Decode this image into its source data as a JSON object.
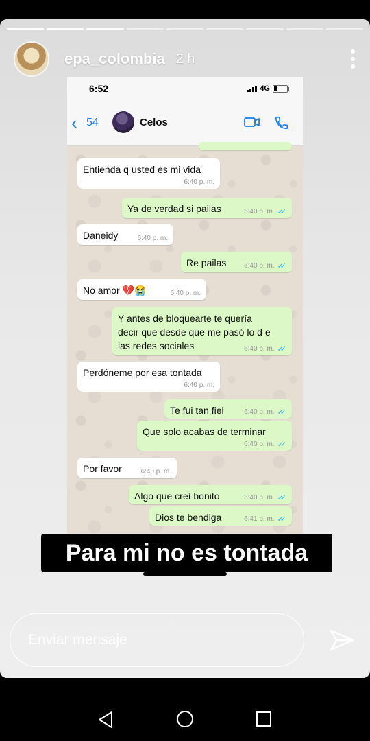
{
  "story": {
    "username": "epa_colombia",
    "time_ago": "2 h",
    "progress_segments": 9,
    "progress_done": 3,
    "caption": "Para mi no es tontada",
    "reply_placeholder": "Enviar mensaje"
  },
  "phone": {
    "status_time": "6:52",
    "network": "4G",
    "back_count": "54",
    "contact_name": "Celos"
  },
  "messages": [
    {
      "dir": "in",
      "text": "Entienda q usted es mi vida",
      "time": "6:40 p. m."
    },
    {
      "dir": "out",
      "text": "Ya de verdad si pailas",
      "time": "6:40 p. m."
    },
    {
      "dir": "in",
      "text": "Daneidy",
      "time": "6:40 p. m."
    },
    {
      "dir": "out",
      "text": "Re pailas",
      "time": "6:40 p. m."
    },
    {
      "dir": "in",
      "text": "No amor 💔😭",
      "time": "6:40 p. m."
    },
    {
      "dir": "out",
      "lines": [
        "Y antes de bloquearte te quería",
        "decir que desde que me pasó lo d e",
        "las redes sociales"
      ],
      "time": "6:40 p. m."
    },
    {
      "dir": "in",
      "text": "Perdóneme por esa tontada",
      "time": "6:40 p. m."
    },
    {
      "dir": "out",
      "text": "Te fui tan fiel",
      "time": "6:40 p. m."
    },
    {
      "dir": "out",
      "text": "Que solo acabas de terminar",
      "time": "6:40 p. m."
    },
    {
      "dir": "in",
      "text": "Por favor",
      "time": "6:40 p. m."
    },
    {
      "dir": "out",
      "text": "Algo que creí bonito",
      "time": "6:40 p. m."
    },
    {
      "dir": "out",
      "text": "Dios te bendiga",
      "time": "6:41 p. m."
    }
  ],
  "icons": {
    "more": "more-vertical-icon",
    "back": "chevron-left-icon",
    "video": "video-camera-icon",
    "call": "phone-icon",
    "read_ticks": "double-check-icon",
    "send": "send-icon",
    "nav_back": "triangle-back-icon",
    "nav_home": "circle-home-icon",
    "nav_recent": "square-recent-icon"
  },
  "colors": {
    "incoming_bubble": "#ffffff",
    "outgoing_bubble": "#dcf8c6",
    "chat_background": "#e6ddd3",
    "read_ticks": "#34b7f1",
    "ios_accent": "#1a7ef0"
  }
}
